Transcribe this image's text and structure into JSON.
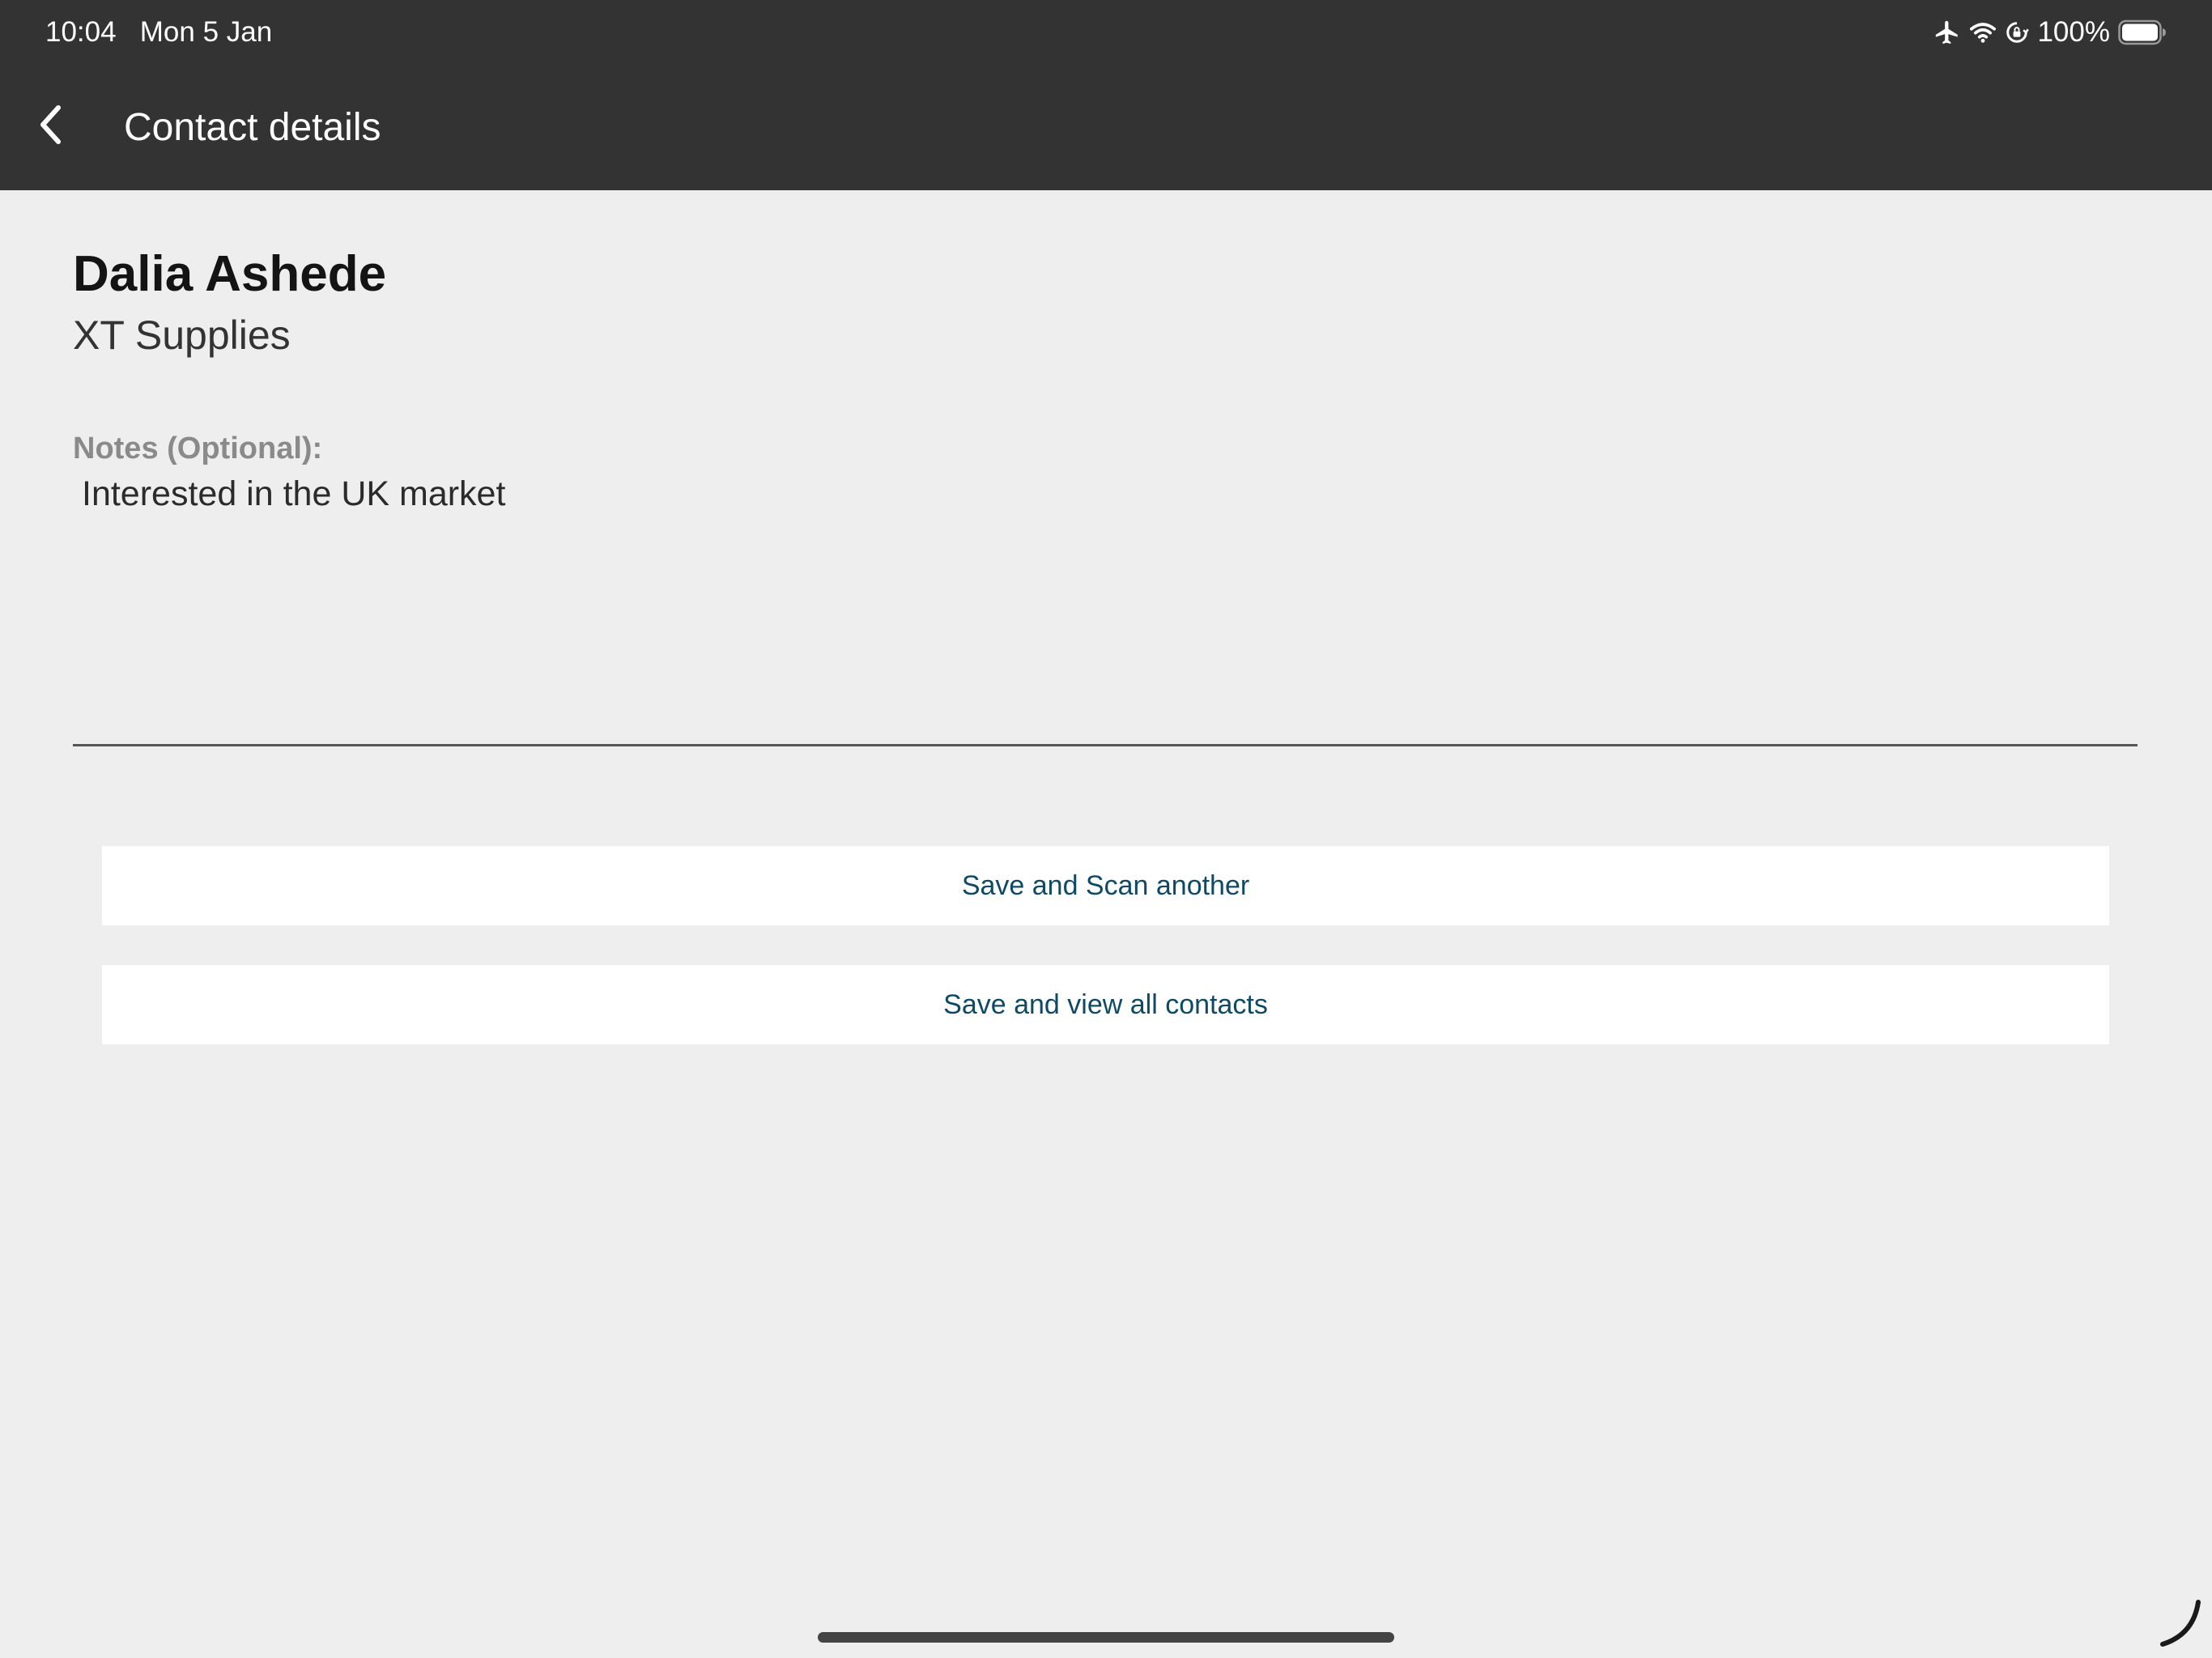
{
  "status_bar": {
    "time": "10:04",
    "date": "Mon 5 Jan",
    "battery_percent": "100%",
    "icons": [
      "airplane-icon",
      "wifi-icon",
      "orientation-lock-icon",
      "battery-icon"
    ]
  },
  "nav": {
    "back_icon": "chevron-left-icon",
    "title": "Contact details"
  },
  "contact": {
    "name": "Dalia Ashede",
    "company": "XT Supplies"
  },
  "notes": {
    "label": "Notes (Optional):",
    "value": "Interested in the UK market"
  },
  "actions": {
    "save_scan_label": "Save and Scan another",
    "save_view_label": "Save and view all contacts"
  },
  "colors": {
    "topbar": "#333333",
    "background": "#eeeeee",
    "button_text": "#0e4a66"
  }
}
